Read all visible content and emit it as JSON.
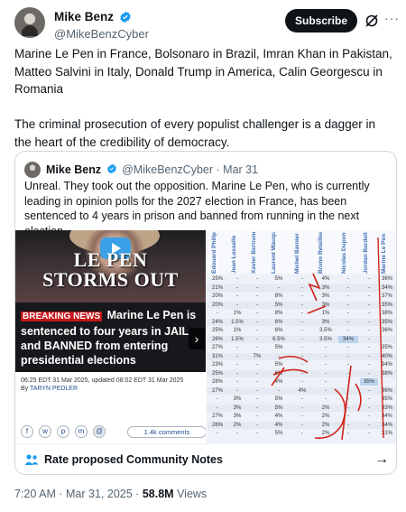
{
  "header": {
    "display_name": "Mike Benz",
    "handle": "@MikeBenzCyber",
    "subscribe_label": "Subscribe",
    "more_label": "···"
  },
  "tweet": {
    "paragraph_1": "Marine Le Pen in France, Bolsonaro in Brazil, Imran Khan in Pakistan, Matteo Salvini in Italy, Donald Trump in America, Calin Georgescu in Romania",
    "paragraph_2": "The criminal prosecution of every populist challenger is a dagger in the heart of the credibility of democracy."
  },
  "quote": {
    "display_name": "Mike Benz",
    "handle": "@MikeBenzCyber",
    "separator": "·",
    "date": "Mar 31",
    "text": "Unreal. They took out the opposition. Marine Le Pen, who is currently leading in opinion polls for the 2027 election in France, has been sentenced to 4 years in prison and banned from running in the next election."
  },
  "article": {
    "image_title_line1": "LE PEN",
    "image_title_line2": "STORMS OUT",
    "breaking_label": "BREAKING NEWS",
    "headline": "Marine Le Pen is sentenced to four years in JAIL and BANNED from entering presidential elections",
    "timestamp": "06:25 EDT 31 Mar 2025, updated 08:02 EDT 31 Mar 2025",
    "by_label": "By",
    "author": "TARYN PEDLER",
    "share_icons": [
      "f",
      "w",
      "p",
      "m",
      "@"
    ],
    "comments_label": "1.4k comments",
    "next_arrow": "›"
  },
  "poll": {
    "columns": [
      "Édouard Philippe",
      "Jean Lassalle",
      "Xavier Bertrand",
      "Laurent Wauquiez",
      "Michel Barnier",
      "Bruno Retailleau",
      "Nicolas Dupont-Aignan",
      "Jordan Bardella",
      "Marine Le Pen"
    ],
    "rows": [
      [
        "25%",
        "-",
        "-",
        "5%",
        "-",
        "4%",
        "-",
        "-",
        "36%"
      ],
      [
        "21%",
        "-",
        "-",
        "-",
        "-",
        "3%",
        "-",
        "-",
        "34%"
      ],
      [
        "20%",
        "-",
        "-",
        "8%",
        "-",
        "3%",
        "-",
        "-",
        "37%"
      ],
      [
        "20%",
        "-",
        "-",
        "5%",
        "-",
        "3%",
        "-",
        "-",
        "35%"
      ],
      [
        "-",
        "1%",
        "-",
        "8%",
        "-",
        "1%",
        "-",
        "-",
        "38%"
      ],
      [
        "24%",
        "1.5%",
        "-",
        "6%",
        "-",
        "3%",
        "-",
        "-",
        "35%"
      ],
      [
        "25%",
        "1%",
        "-",
        "6%",
        "-",
        "3.5%",
        "-",
        "-",
        "36%"
      ],
      [
        "26%",
        "1.5%",
        "-",
        "6.5%",
        "-",
        "3.5%",
        "34%",
        "-",
        ""
      ],
      [
        "27%",
        "-",
        "-",
        "5%",
        "-",
        "-",
        "-",
        "-",
        "35%"
      ],
      [
        "31%",
        "-",
        "7%",
        "-",
        "-",
        "-",
        "-",
        "-",
        "40%"
      ],
      [
        "23%",
        "-",
        "-",
        "5%",
        "-",
        "-",
        "-",
        "-",
        "34%"
      ],
      [
        "25%",
        "-",
        "-",
        "6%",
        "-",
        "-",
        "-",
        "-",
        "38%"
      ],
      [
        "28%",
        "-",
        "-",
        "4%",
        "-",
        "-",
        "-",
        "35%",
        ""
      ],
      [
        "27%",
        "-",
        "-",
        "-",
        "4%",
        "-",
        "-",
        "-",
        "36%"
      ],
      [
        "-",
        "3%",
        "-",
        "5%",
        "-",
        "-",
        "-",
        "-",
        "35%"
      ],
      [
        "-",
        "3%",
        "-",
        "5%",
        "-",
        "2%",
        "-",
        "-",
        "33%"
      ],
      [
        "27%",
        "3%",
        "-",
        "4%",
        "-",
        "2%",
        "-",
        "-",
        "34%"
      ],
      [
        "26%",
        "2%",
        "-",
        "4%",
        "-",
        "2%",
        "-",
        "-",
        "34%"
      ],
      [
        "-",
        "-",
        "-",
        "5%",
        "-",
        "2%",
        "-",
        "-",
        "31%"
      ]
    ]
  },
  "community_notes": {
    "label": "Rate proposed Community Notes",
    "arrow": "→"
  },
  "footer": {
    "time": "7:20 AM",
    "separator_1": "·",
    "date": "Mar 31, 2025",
    "separator_2": "·",
    "views": "58.8M",
    "views_label": "Views"
  },
  "colors": {
    "brand_blue": "#1d9bf0",
    "breaking_red": "#c4171b",
    "pen_red": "#d0241c"
  }
}
